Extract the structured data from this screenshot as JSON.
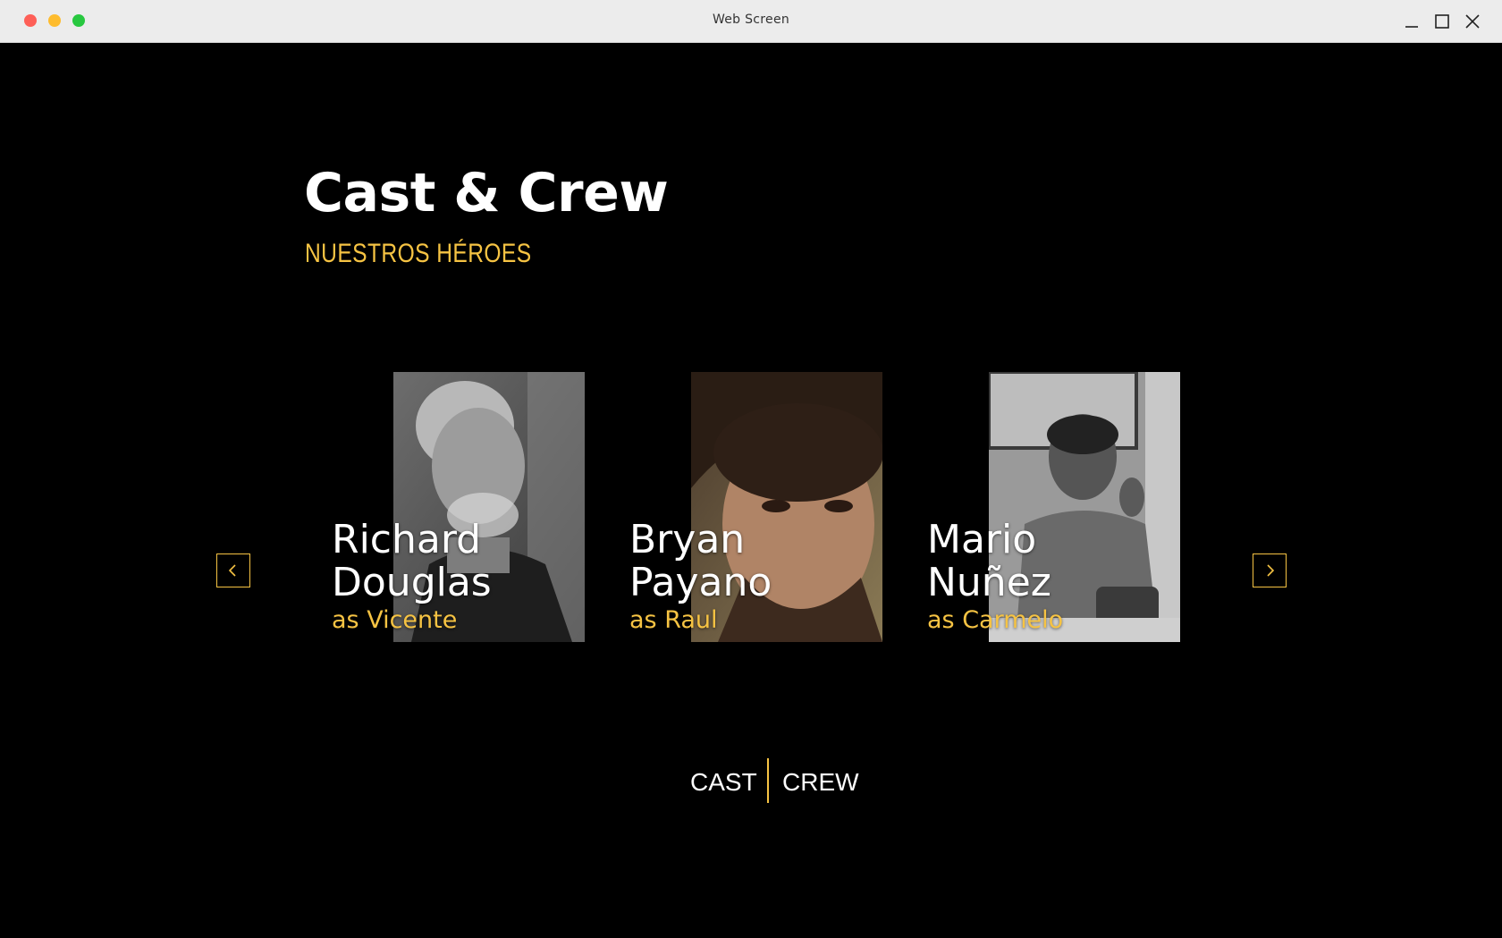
{
  "window": {
    "title": "Web Screen"
  },
  "page": {
    "heading": "Cast & Crew",
    "subheading": "NUESTROS HÉROES"
  },
  "carousel": {
    "cards": [
      {
        "name_line1": "Richard",
        "name_line2": "Douglas",
        "role": "as Vicente",
        "photo_style": "grayscale"
      },
      {
        "name_line1": "Bryan",
        "name_line2": "Payano",
        "role": "as Raul",
        "photo_style": "color"
      },
      {
        "name_line1": "Mario",
        "name_line2": "Nuñez",
        "role": "as Carmelo",
        "photo_style": "grayscale"
      }
    ]
  },
  "toggle": {
    "cast_label": "CAST",
    "crew_label": "CREW"
  },
  "colors": {
    "accent": "#f6c343",
    "background": "#000000",
    "text": "#ffffff"
  },
  "icons": {
    "prev": "chevron-left-icon",
    "next": "chevron-right-icon"
  }
}
